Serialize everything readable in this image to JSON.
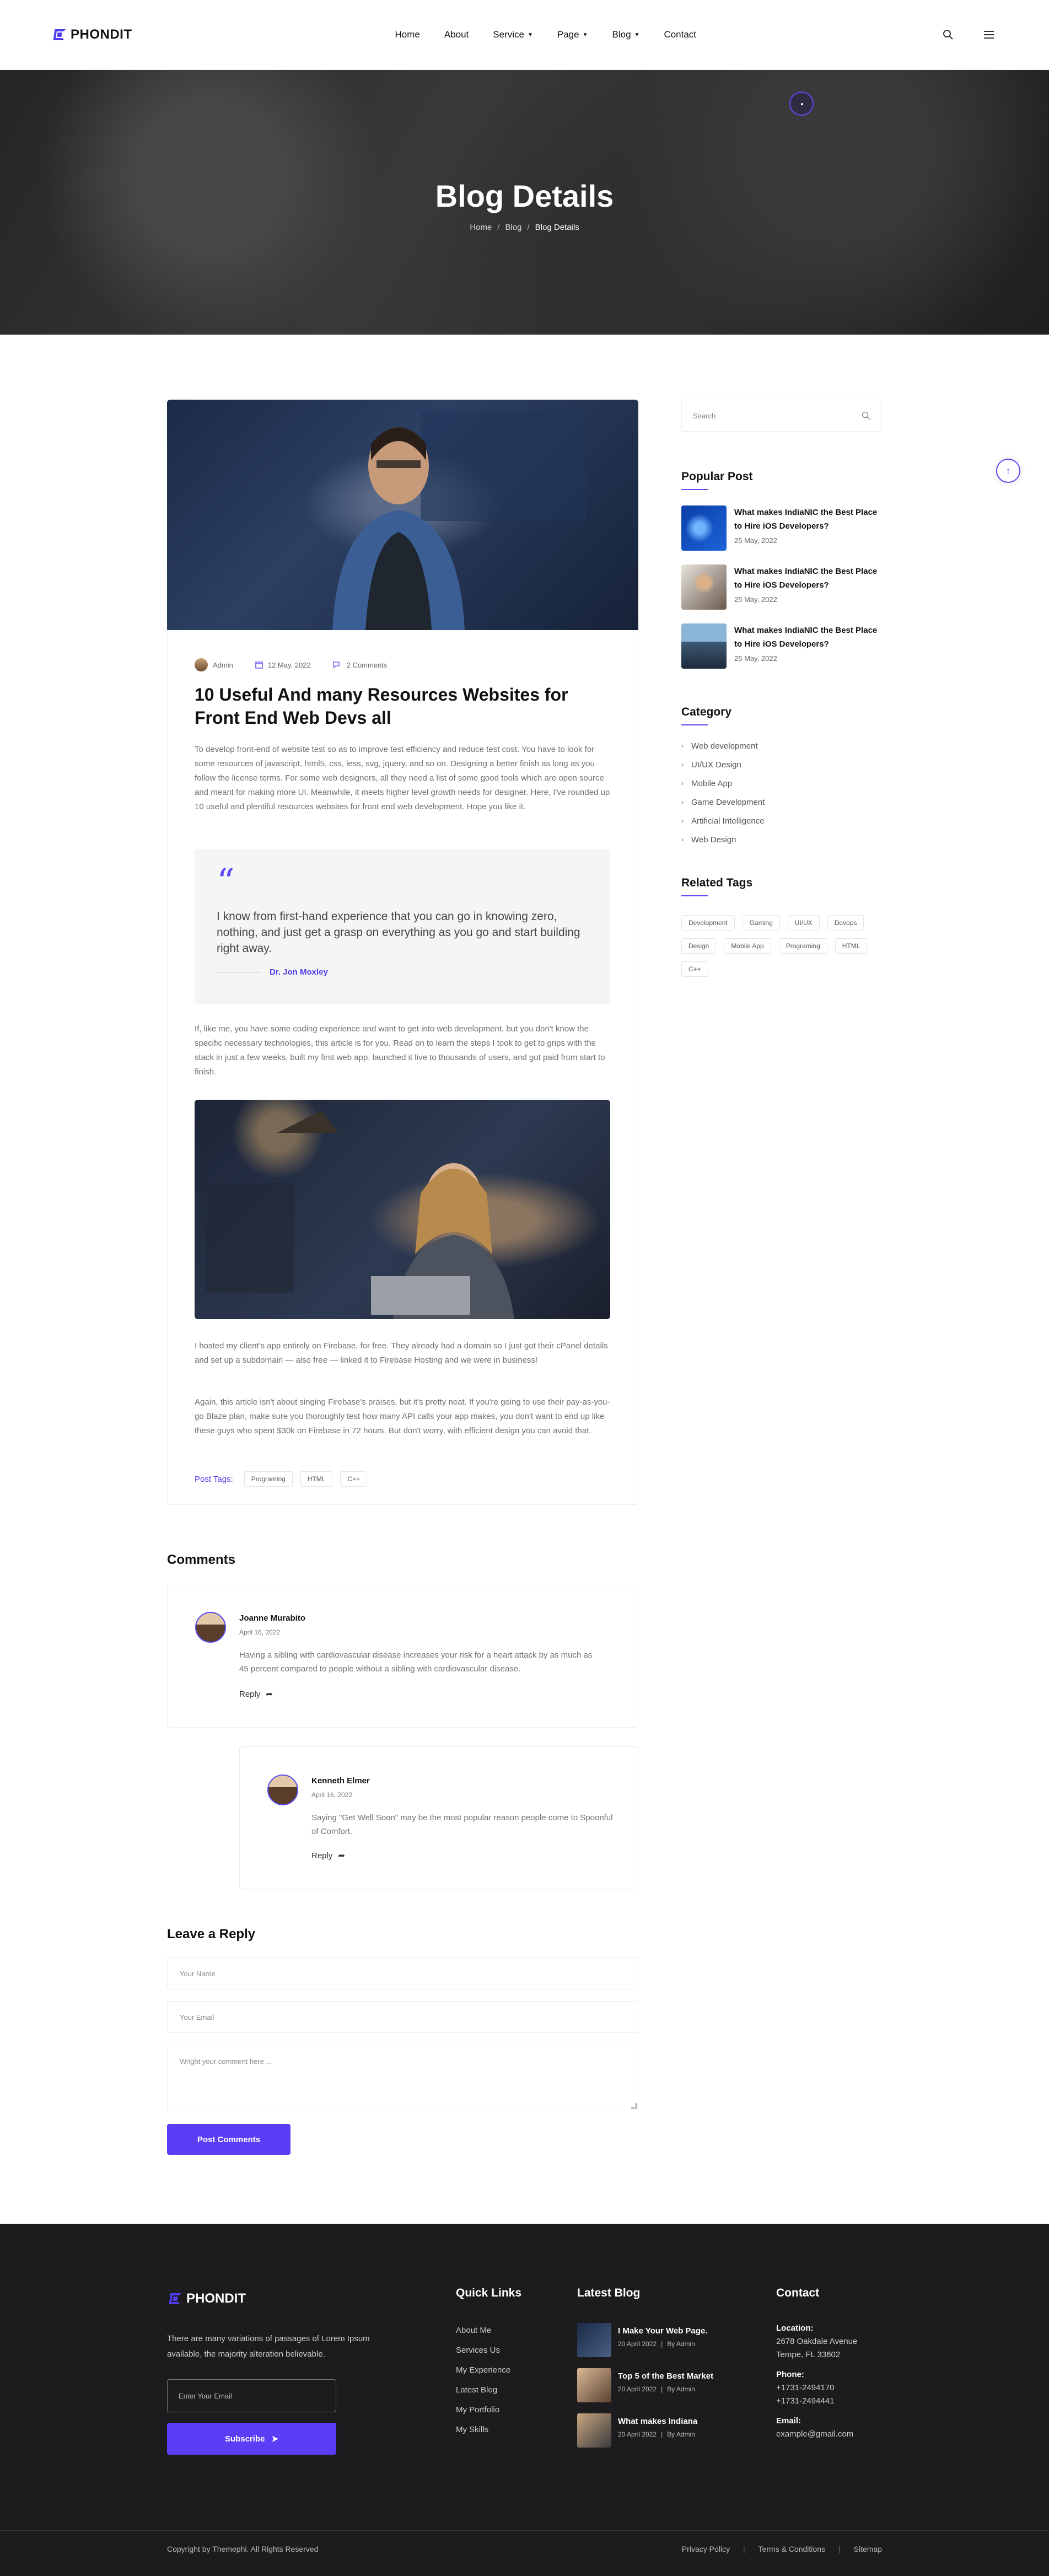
{
  "brand": {
    "name": "PHONDIT",
    "accent": "#5b3df5"
  },
  "nav": {
    "items": [
      {
        "label": "Home",
        "caret": false
      },
      {
        "label": "About",
        "caret": false
      },
      {
        "label": "Service",
        "caret": true
      },
      {
        "label": "Page",
        "caret": true
      },
      {
        "label": "Blog",
        "caret": true
      },
      {
        "label": "Contact",
        "caret": false
      }
    ],
    "icons": [
      "search-icon",
      "menu-icon"
    ]
  },
  "hero": {
    "title": "Blog Details",
    "breadcrumb": [
      "Home",
      "Blog",
      "Blog Details"
    ]
  },
  "article": {
    "meta": {
      "author": "Admin",
      "date": "12 May, 2022",
      "comments": "2 Comments"
    },
    "title": "10 Useful And many Resources Websites for Front End Web Devs all",
    "intro": "To develop front-end of website test so as to improve test efficiency and reduce test cost. You have to look for some resources of javascript, html5, css, less, svg, jquery, and so on. Designing a better finish as long as you follow the license terms. For some web designers, all they need a list of some good tools which are open source and meant for making more UI. Meanwhile, it meets higher level growth needs for designer. Here, I've rounded up 10 useful and plentiful resources websites for front end web development. Hope you like it.",
    "quote": {
      "text": "I know from first-hand experience that you can go in knowing zero, nothing, and just get a grasp on everything as you go and start building right away.",
      "author": "Dr. Jon Moxley"
    },
    "para2": "If, like me, you have some coding experience and want to get into web development, but you don't know the specific necessary technologies, this article is for you. Read on to learn the steps I took to get to grips with the stack in just a few weeks, built my first web app, launched it live to thousands of users, and got paid from start to finish.",
    "para3": "I hosted my client's app entirely on Firebase, for free. They already had a domain so I just got their cPanel details and set up a subdomain — also free — linked it to Firebase Hosting and we were in business!",
    "para4": "Again, this article isn't about singing Firebase's praises, but it's pretty neat. If you're going to use their pay-as-you-go Blaze plan, make sure you thoroughly test how many API calls your app makes, you don't want to end up like these guys who spent $30k on Firebase in 72 hours. But don't worry, with efficient design you can avoid that.",
    "tags_label": "Post Tags:",
    "tags": [
      "Programing",
      "HTML",
      "C++"
    ]
  },
  "comments": {
    "heading": "Comments",
    "items": [
      {
        "name": "Joanne Murabito",
        "date": "April 16, 2022",
        "text": "Having a sibling with cardiovascular disease increases your risk for a heart attack by as much as 45 percent compared to people without a sibling with cardiovascular disease.",
        "reply": "Reply"
      },
      {
        "name": "Kenneth Elmer",
        "date": "April 16, 2022",
        "text": "Saying \"Get Well Soon\" may be the most popular reason people come to Spoonful of Comfort.",
        "reply": "Reply"
      }
    ]
  },
  "reply_form": {
    "heading": "Leave a Reply",
    "name_placeholder": "Your Name",
    "email_placeholder": "Your Email",
    "comment_placeholder": "Wright your comment here ...",
    "submit": "Post Comments"
  },
  "sidebar": {
    "search_placeholder": "Search",
    "popular_heading": "Popular Post",
    "popular": [
      {
        "title": "What makes IndiaNIC the Best Place to Hire iOS Developers?",
        "date": "25 May, 2022"
      },
      {
        "title": "What makes IndiaNIC the Best Place to Hire iOS Developers?",
        "date": "25 May, 2022"
      },
      {
        "title": "What makes IndiaNIC the Best Place to Hire iOS Developers?",
        "date": "25 May, 2022"
      }
    ],
    "category_heading": "Category",
    "categories": [
      "Web development",
      "UI/UX Design",
      "Mobile App",
      "Game Development",
      "Artificial Intelligence",
      "Web Design"
    ],
    "tags_heading": "Related Tags",
    "tags": [
      "Development",
      "Gaming",
      "UI/UX",
      "Devops",
      "Design",
      "Mobile App",
      "Programing",
      "HTML",
      "C++"
    ]
  },
  "footer": {
    "brand": "PHONDIT",
    "desc": "There are many variations of passages of Lorem Ipsum available, the majority alteration believable.",
    "email_placeholder": "Enter Your Email",
    "subscribe": "Subscribe",
    "quick_links_heading": "Quick Links",
    "quick_links": [
      "About Me",
      "Services Us",
      "My Experience",
      "Latest Blog",
      "My Portfolio",
      "My Skills"
    ],
    "latest_heading": "Latest Blog",
    "latest": [
      {
        "title": "I Make Your Web Page.",
        "date": "20 April 2022",
        "by": "By Admin"
      },
      {
        "title": "Top 5 of the Best Market",
        "date": "20 April 2022",
        "by": "By Admin"
      },
      {
        "title": "What makes Indiana",
        "date": "20 April 2022",
        "by": "By Admin"
      }
    ],
    "contact_heading": "Contact",
    "location_label": "Location:",
    "location": "2678 Oakdale Avenue Tempe, FL 33602",
    "phone_label": "Phone:",
    "phones": [
      "+1731-2494170",
      "+1731-2494441"
    ],
    "email_label": "Email:",
    "email": "example@gmail.com",
    "copyright": "Copyright by Themephi. All Rights Reserved",
    "bottom_links": [
      "Privacy Policy",
      "Terms & Conditions",
      "Sitemap"
    ]
  }
}
